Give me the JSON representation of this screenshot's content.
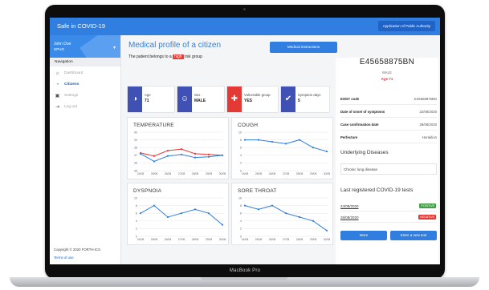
{
  "app": {
    "title": "Safe in COVID-19",
    "authority_button": "Application of Public Authority",
    "device_label": "MacBook Pro"
  },
  "user": {
    "name": "John Doe",
    "role": "NPHO"
  },
  "sidebar": {
    "section": "Navigation",
    "items": [
      {
        "label": "Dashboard",
        "icon": "home-icon",
        "active": false
      },
      {
        "label": "Citizens",
        "icon": "citizens-icon",
        "active": true
      },
      {
        "label": "Settings",
        "icon": "settings-icon",
        "active": false
      },
      {
        "label": "Log out",
        "icon": "logout-icon",
        "active": false
      }
    ],
    "copyright": "Copyright © 2020 FORTH-ICS",
    "terms": "Terms of use"
  },
  "profile": {
    "title": "Medical profile of a citizen",
    "subtitle_before": "The patient belongs to a",
    "risk_tag": "high",
    "subtitle_after": "risk group",
    "instructions_button": "Medical instructions"
  },
  "cards": [
    {
      "label": "Age",
      "value": "71",
      "icon": "age-icon",
      "color": "#3f51b5"
    },
    {
      "label": "Sex",
      "value": "MALE",
      "icon": "person-icon",
      "color": "#3f51b5"
    },
    {
      "label": "Vulnerable group",
      "value": "YES",
      "icon": "medical-cross-icon",
      "color": "#e53935"
    },
    {
      "label": "Symptom days",
      "value": "5",
      "icon": "shield-check-icon",
      "color": "#3f51b5"
    }
  ],
  "charts": {
    "x_labels": [
      "24/08",
      "25/08",
      "26/08",
      "27/08",
      "28/08",
      "29/08",
      "30/08"
    ],
    "temperature": {
      "title": "TEMPERATURE",
      "y_ticks": [
        40,
        39,
        38,
        37,
        36,
        35
      ],
      "ylim": [
        35,
        40
      ],
      "series": [
        {
          "color": "#e53935",
          "values": [
            37.3,
            36.9,
            37.6,
            37.8,
            37.2,
            37.1,
            37.0
          ]
        },
        {
          "color": "#2f7ee0",
          "values": [
            37.2,
            36.2,
            36.9,
            37.1,
            36.7,
            36.8,
            37.0
          ]
        }
      ]
    },
    "cough": {
      "title": "COUGH",
      "y_ticks": [
        10,
        8,
        6,
        4,
        2,
        0
      ],
      "ylim": [
        0,
        10
      ],
      "series": [
        {
          "color": "#2f7ee0",
          "values": [
            8,
            8,
            7.5,
            7,
            8,
            6,
            5
          ]
        }
      ]
    },
    "dyspnoia": {
      "title": "DYSPNOIA",
      "y_ticks": [
        10,
        8,
        6,
        4,
        2,
        0
      ],
      "ylim": [
        0,
        10
      ],
      "series": [
        {
          "color": "#2f7ee0",
          "values": [
            6,
            8,
            5,
            6,
            7,
            6,
            3
          ]
        }
      ]
    },
    "sore_throat": {
      "title": "SORE THROAT",
      "y_ticks": [
        10,
        8,
        6,
        4,
        2,
        0
      ],
      "ylim": [
        0,
        10
      ],
      "series": [
        {
          "color": "#2f7ee0",
          "values": [
            8,
            7,
            8,
            6,
            5,
            4,
            1.5
          ]
        }
      ]
    }
  },
  "details": {
    "patient_id": "E45658875BN",
    "sex": "MALE",
    "age_line": "Age 71",
    "rows": [
      {
        "k": "EODY code",
        "v": "E45658875BN"
      },
      {
        "k": "Date of onset of symptoms",
        "v": "22/08/2020"
      },
      {
        "k": "Case confirmation date",
        "v": "28/08/2020"
      },
      {
        "k": "Perfecture",
        "v": "Heraklion"
      }
    ],
    "diseases_title": "Underlying Diseases",
    "disease": "Chronic lung disease",
    "tests_title": "Last registered COVID-19 tests",
    "tests": [
      {
        "date": "24/08/2020",
        "result": "POSITIVE",
        "color": "#43a047"
      },
      {
        "date": "26/08/2020",
        "result": "NEGATIVE",
        "color": "#e53935"
      }
    ],
    "more_button": "More",
    "new_test_button": "Enter a new test"
  }
}
